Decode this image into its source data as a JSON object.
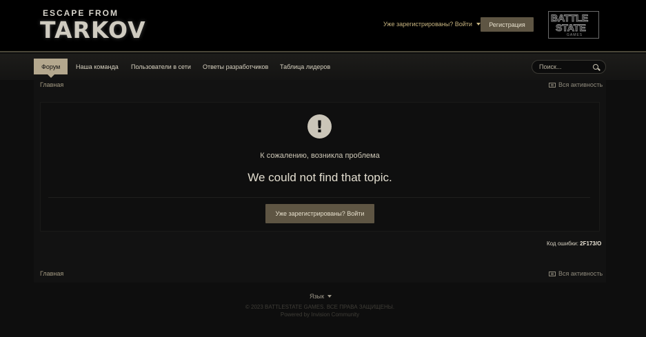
{
  "header": {
    "logo_line1": "ESCAPE FROM",
    "logo_line2": "TARKOV",
    "login_link": "Уже зарегистрированы? Войти",
    "register_button": "Регистрация",
    "bsg_line1": "BATTLE",
    "bsg_line2": "STATE",
    "bsg_line3": "GAMES"
  },
  "nav": {
    "items": [
      {
        "label": "Форум",
        "active": true
      },
      {
        "label": "Наша команда",
        "active": false
      },
      {
        "label": "Пользователи в сети",
        "active": false
      },
      {
        "label": "Ответы разработчиков",
        "active": false
      },
      {
        "label": "Таблица лидеров",
        "active": false
      }
    ],
    "search_placeholder": "Поиск..."
  },
  "breadcrumb": {
    "home": "Главная",
    "all_activity": "Вся активность"
  },
  "error": {
    "sorry_text": "К сожалению, возникла проблема",
    "message": "We could not find that topic.",
    "login_button": "Уже зарегистрированы? Войти",
    "code_label": "Код ошибки:",
    "code_value": "2F173/O"
  },
  "footer": {
    "language": "Язык",
    "copyright": "© 2023 BATTLESTATE GAMES. ВСЕ ПРАВА ЗАЩИЩЕНЫ.",
    "powered": "Powered by Invision Community"
  },
  "colors": {
    "accent": "#5e5543",
    "nav_active": "#b4a88e",
    "link": "#c8b580"
  }
}
